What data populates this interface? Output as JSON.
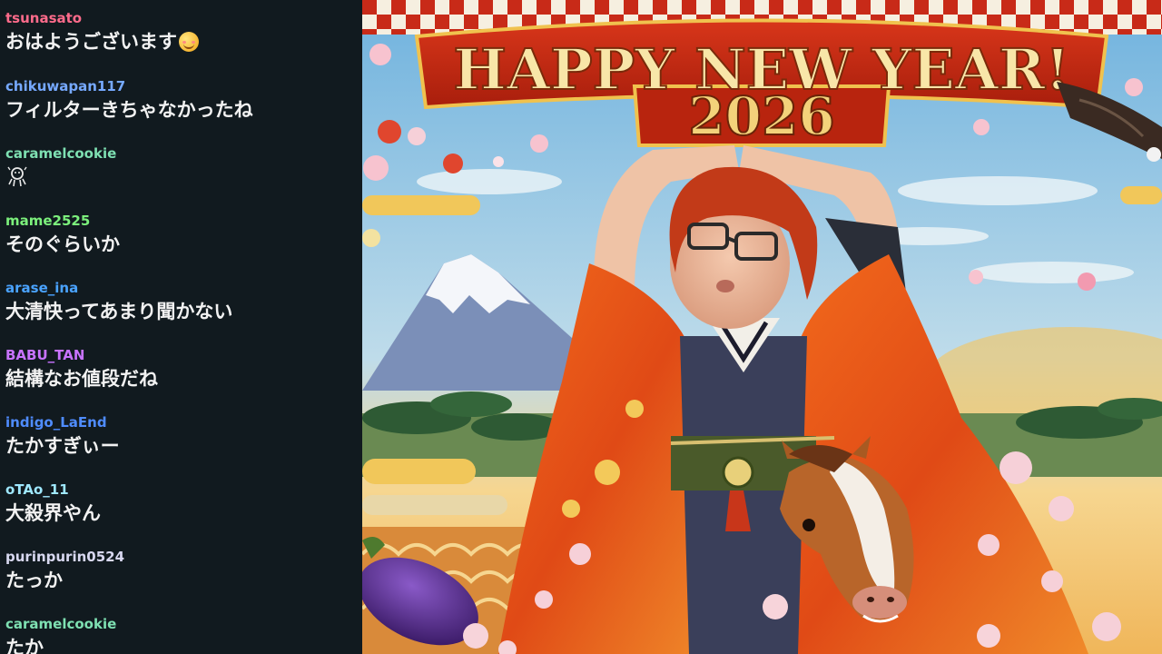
{
  "chat": {
    "messages": [
      {
        "user": "tsunasato",
        "color": "#ff6b8b",
        "text": "おはようございます"
      },
      {
        "user": "chikuwapan117",
        "color": "#76a9ff",
        "text": "フィルターきちゃなかったね"
      },
      {
        "user": "caramelcookie",
        "color": "#7ee0b2",
        "text": ""
      },
      {
        "user": "mame2525",
        "color": "#7cf07c",
        "text": "そのぐらいか"
      },
      {
        "user": "arase_ina",
        "color": "#4aa3ff",
        "text": "大清快ってあまり聞かない"
      },
      {
        "user": "BABU_TAN",
        "color": "#c873ff",
        "text": "結構なお値段だね"
      },
      {
        "user": "indigo_LaEnd",
        "color": "#4f8cff",
        "text": "たかすぎぃー"
      },
      {
        "user": "oTAo_11",
        "color": "#9fe8ff",
        "text": "大殺界やん"
      },
      {
        "user": "purinpurin0524",
        "color": "#d8d8f0",
        "text": "たっか"
      },
      {
        "user": "caramelcookie",
        "color": "#7ee0b2",
        "text": "たか"
      }
    ]
  },
  "stream": {
    "banner_title": "HAPPY NEW YEAR!",
    "banner_year": "2026",
    "colors": {
      "banner_red": "#c42a12",
      "gold": "#f3d27a",
      "sky": "#8fc3e3",
      "kimono_orange": "#e8551a"
    }
  }
}
